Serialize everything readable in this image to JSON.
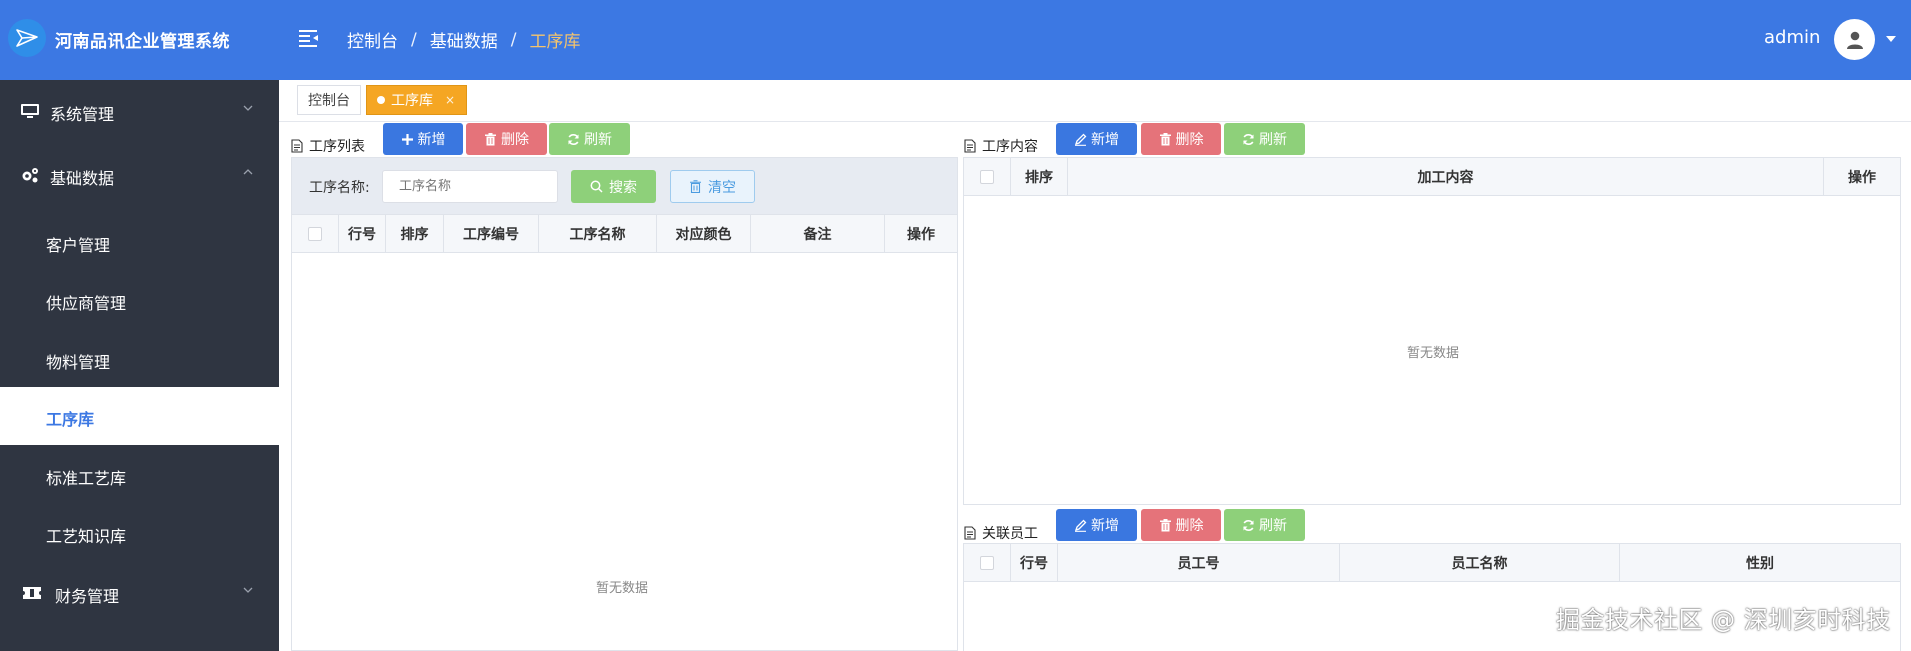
{
  "header": {
    "app_title": "河南品讯企业管理系统",
    "breadcrumb": [
      "控制台",
      "基础数据",
      "工序库"
    ],
    "breadcrumb_sep": "/",
    "username": "admin"
  },
  "sidebar": {
    "groups": [
      {
        "label": "系统管理",
        "icon": "monitor-icon"
      },
      {
        "label": "基础数据",
        "icon": "gears-icon"
      },
      {
        "label": "财务管理",
        "icon": "ticket-icon"
      }
    ],
    "items": [
      "客户管理",
      "供应商管理",
      "物料管理",
      "工序库",
      "标准工艺库",
      "工艺知识库"
    ],
    "active_item": "工序库"
  },
  "tabs": [
    {
      "label": "控制台"
    },
    {
      "label": "工序库",
      "close": "×"
    }
  ],
  "process_list": {
    "title": "工序列表",
    "buttons": {
      "add": "新增",
      "delete": "删除",
      "refresh": "刷新"
    },
    "search_label": "工序名称:",
    "search_placeholder": "工序名称",
    "search_button": "搜索",
    "clear_button": "清空",
    "columns": [
      "行号",
      "排序",
      "工序编号",
      "工序名称",
      "对应颜色",
      "备注",
      "操作"
    ],
    "empty_text": "暂无数据"
  },
  "process_content": {
    "title": "工序内容",
    "buttons": {
      "add": "新增",
      "delete": "删除",
      "refresh": "刷新"
    },
    "columns": [
      "排序",
      "加工内容",
      "操作"
    ],
    "empty_text": "暂无数据"
  },
  "related_staff": {
    "title": "关联员工",
    "buttons": {
      "add": "新增",
      "delete": "删除",
      "refresh": "刷新"
    },
    "columns": [
      "行号",
      "员工号",
      "员工名称",
      "性别"
    ]
  },
  "watermark": "掘金技术社区 @ 深圳亥时科技",
  "colors": {
    "header": "#3c78e3",
    "sidebar": "#2f3541",
    "active_tab": "#f5a623",
    "btn_blue": "#3a77e0",
    "btn_red": "#e5737a",
    "btn_green": "#8ed07a"
  }
}
